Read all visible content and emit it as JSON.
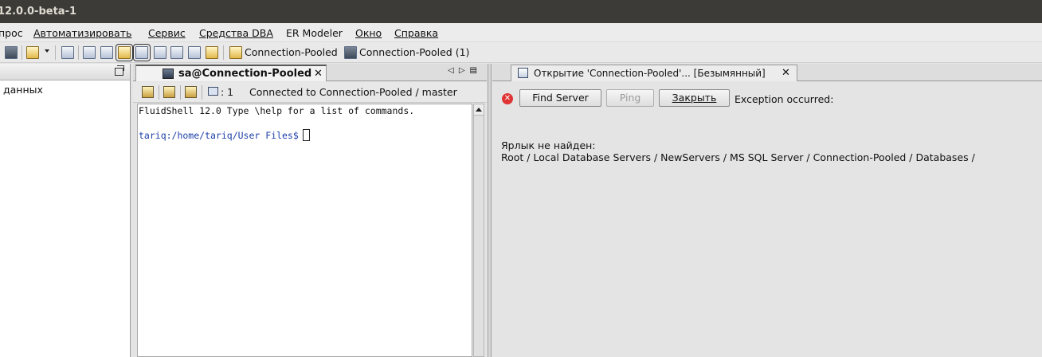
{
  "window": {
    "title": "12.0.0-beta-1"
  },
  "menu": {
    "items": [
      {
        "label": "прос"
      },
      {
        "label": "Автоматизировать"
      },
      {
        "label": "Сервис"
      },
      {
        "label": "Средства DBA"
      },
      {
        "label": "ER Modeler"
      },
      {
        "label": "Окно"
      },
      {
        "label": "Справка"
      }
    ]
  },
  "toolbar": {
    "connection_1": "Connection-Pooled",
    "connection_2": "Connection-Pooled (1)"
  },
  "left_panel": {
    "item": "данных"
  },
  "shell_tab": {
    "label": "sa@Connection-Pooled",
    "close": "✕",
    "line_number": ": 1",
    "status": "Connected to Connection-Pooled / master",
    "console_line": "FluidShell 12.0  Type \\help for a list of commands.",
    "prompt": "tariq:/home/tariq/User Files$"
  },
  "open_tab": {
    "label": "Открытие 'Connection-Pooled'... [Безымянный]",
    "close": "✕",
    "find_server": "Find Server",
    "ping": "Ping",
    "close_button": "Закрыть",
    "exception": "Exception occurred:",
    "shortcut_not_found": "Ярлык не найден:",
    "path": "Root / Local Database Servers / NewServers / MS SQL Server / Connection-Pooled / Databases /"
  }
}
